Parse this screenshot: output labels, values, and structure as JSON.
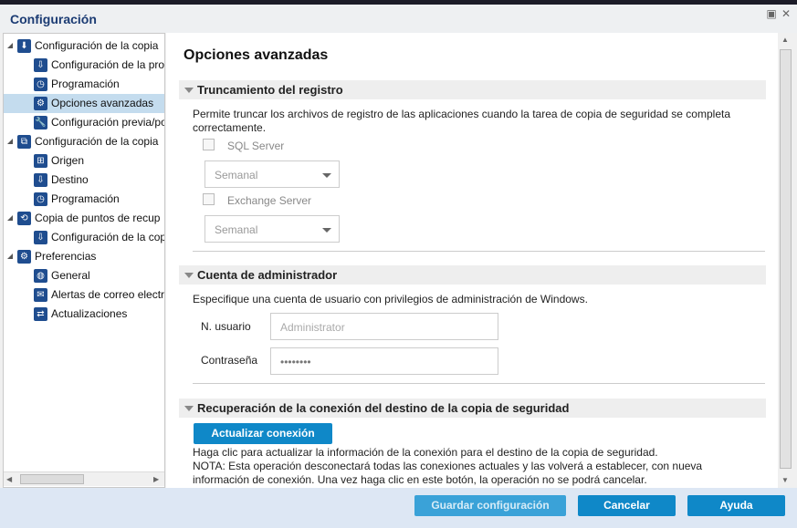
{
  "window": {
    "title": "Configuración"
  },
  "tree": [
    {
      "label": "Configuración de la copia",
      "level": 0,
      "icon": "backup-icon"
    },
    {
      "label": "Configuración de la pro",
      "level": 1,
      "icon": "destination-icon"
    },
    {
      "label": "Programación",
      "level": 1,
      "icon": "schedule-icon"
    },
    {
      "label": "Opciones avanzadas",
      "level": 1,
      "icon": "advanced-gear-icon",
      "selected": true
    },
    {
      "label": "Configuración previa/po",
      "level": 1,
      "icon": "wrench-icon"
    },
    {
      "label": "Configuración de la copia",
      "level": 0,
      "icon": "file-copy-icon"
    },
    {
      "label": "Origen",
      "level": 1,
      "icon": "network-icon"
    },
    {
      "label": "Destino",
      "level": 1,
      "icon": "destination-icon"
    },
    {
      "label": "Programación",
      "level": 1,
      "icon": "schedule-icon"
    },
    {
      "label": "Copia de puntos de recup",
      "level": 0,
      "icon": "recovery-copy-icon"
    },
    {
      "label": "Configuración de la cop",
      "level": 1,
      "icon": "destination-icon"
    },
    {
      "label": "Preferencias",
      "level": 0,
      "icon": "preferences-icon"
    },
    {
      "label": "General",
      "level": 1,
      "icon": "globe-icon"
    },
    {
      "label": "Alertas de correo electr",
      "level": 1,
      "icon": "mail-icon"
    },
    {
      "label": "Actualizaciones",
      "level": 1,
      "icon": "updates-icon"
    }
  ],
  "main": {
    "title": "Opciones avanzadas",
    "truncation": {
      "header": "Truncamiento del registro",
      "description": "Permite truncar los archivos de registro de las aplicaciones cuando la tarea de copia de seguridad se completa correctamente.",
      "sql_label": "SQL Server",
      "sql_freq": "Semanal",
      "exchange_label": "Exchange Server",
      "exchange_freq": "Semanal"
    },
    "admin": {
      "header": "Cuenta de administrador",
      "description": "Especifique una cuenta de usuario con privilegios de administración de Windows.",
      "user_label": "N. usuario",
      "user_value": "Administrator",
      "password_label": "Contraseña",
      "password_value": "••••••••"
    },
    "recovery": {
      "header": "Recuperación de la conexión del destino de la copia de seguridad",
      "button": "Actualizar conexión",
      "line1": "Haga clic para actualizar la información de la conexión para el destino de la copia de seguridad.",
      "line2": "NOTA: Esta operación desconectará todas las conexiones actuales y las volverá a establecer, con nueva",
      "line3": "información de conexión. Una vez haga clic en este botón, la operación no se podrá cancelar."
    }
  },
  "footer": {
    "save": "Guardar configuración",
    "cancel": "Cancelar",
    "help": "Ayuda"
  }
}
